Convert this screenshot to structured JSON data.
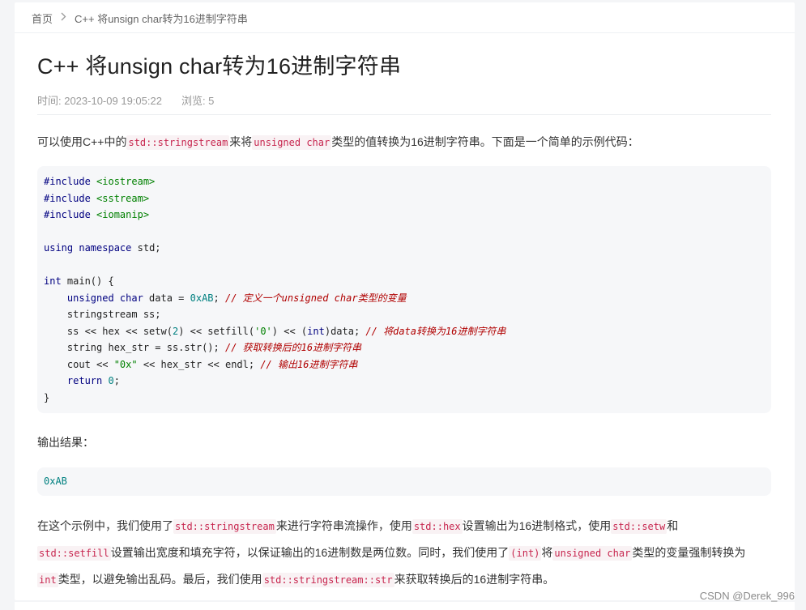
{
  "breadcrumb": {
    "home": "首页",
    "current": "C++ 将unsign char转为16进制字符串"
  },
  "article": {
    "title": "C++ 将unsign char转为16进制字符串",
    "meta": {
      "time": "时间: 2023-10-09 19:05:22",
      "views": "浏览: 5"
    },
    "intro": {
      "t1": "可以使用C++中的",
      "c1": "std::stringstream",
      "t2": "来将",
      "c2": "unsigned char",
      "t3": "类型的值转换为16进制字符串。下面是一个简单的示例代码："
    },
    "code_lines": {
      "l1a": "#include",
      "l1b": "<iostream>",
      "l2a": "#include",
      "l2b": "<sstream>",
      "l3a": "#include",
      "l3b": "<iomanip>",
      "l5a": "using",
      "l5b": "namespace",
      "l5c": " std;",
      "l7a": "int",
      "l7b": " main() {",
      "l8a": "unsigned char",
      "l8b": " data = ",
      "l8c": "0xAB",
      "l8d": "; ",
      "l8e": "// 定义一个unsigned char类型的变量",
      "l9a": "stringstream ss;",
      "l10a": "ss << hex << setw(",
      "l10b": "2",
      "l10c": ") << setfill(",
      "l10d": "'0'",
      "l10e": ") << (",
      "l10f": "int",
      "l10g": ")data; ",
      "l10h": "// 将data转换为16进制字符串",
      "l11a": "string hex_str = ss.str(); ",
      "l11b": "// 获取转换后的16进制字符串",
      "l12a": "cout << ",
      "l12b": "\"0x\"",
      "l12c": " << hex_str << endl; ",
      "l12d": "// 输出16进制字符串",
      "l13a": "return",
      "l13b": "0",
      "l13c": ";",
      "l14a": "}"
    },
    "output_label": "输出结果：",
    "output_value": "0xAB",
    "summary": {
      "t1": "在这个示例中，我们使用了",
      "c1": "std::stringstream",
      "t2": "来进行字符串流操作，使用",
      "c2": "std::hex",
      "t3": "设置输出为16进制格式，使用",
      "c3": "std::setw",
      "t4": "和",
      "c4": "std::setfill",
      "t5": "设置输出宽度和填充字符，以保证输出的16进制数是两位数。同时，我们使用了",
      "c5": "(int)",
      "t6": "将",
      "c6": "unsigned char",
      "t7": "类型的变量强制转换为",
      "c7": "int",
      "t8": "类型，以避免输出乱码。最后，我们使用",
      "c8": "std::stringstream::str",
      "t9": "来获取转换后的16进制字符串。"
    }
  },
  "watermark": "CSDN @Derek_996"
}
